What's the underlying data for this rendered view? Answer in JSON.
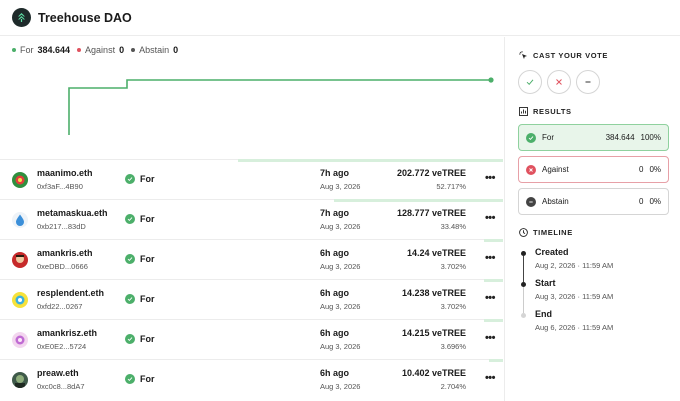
{
  "app": {
    "title": "Treehouse DAO"
  },
  "tally": {
    "for_label": "For",
    "for_value": "384.644",
    "against_label": "Against",
    "against_value": "0",
    "abstain_label": "Abstain",
    "abstain_value": "0"
  },
  "colors": {
    "for": "#4caf6a",
    "against": "#e0525f",
    "abstain": "#555555",
    "bar": "#d7efdc"
  },
  "votes": [
    {
      "name": "maanimo.eth",
      "address": "0xf3aF...4B90",
      "choice": "For",
      "ago": "7h ago",
      "date": "Aug 3, 2026",
      "power": "202.772 veTREE",
      "percent": "52.717%",
      "share": 0.527,
      "avatar": "green"
    },
    {
      "name": "metamaskua.eth",
      "address": "0xb217...83dD",
      "choice": "For",
      "ago": "7h ago",
      "date": "Aug 3, 2026",
      "power": "128.777 veTREE",
      "percent": "33.48%",
      "share": 0.335,
      "avatar": "drop"
    },
    {
      "name": "amankris.eth",
      "address": "0xeDBD...0666",
      "choice": "For",
      "ago": "6h ago",
      "date": "Aug 3, 2026",
      "power": "14.24 veTREE",
      "percent": "3.702%",
      "share": 0.037,
      "avatar": "red"
    },
    {
      "name": "resplendent.eth",
      "address": "0xfd22...0267",
      "choice": "For",
      "ago": "6h ago",
      "date": "Aug 3, 2026",
      "power": "14.238 veTREE",
      "percent": "3.702%",
      "share": 0.037,
      "avatar": "yellow"
    },
    {
      "name": "amankrisz.eth",
      "address": "0xE0E2...5724",
      "choice": "For",
      "ago": "6h ago",
      "date": "Aug 3, 2026",
      "power": "14.215 veTREE",
      "percent": "3.696%",
      "share": 0.037,
      "avatar": "pink"
    },
    {
      "name": "preaw.eth",
      "address": "0xc0c8...8dA7",
      "choice": "For",
      "ago": "6h ago",
      "date": "Aug 3, 2026",
      "power": "10.402 veTREE",
      "percent": "2.704%",
      "share": 0.027,
      "avatar": "dark"
    }
  ],
  "cast": {
    "title": "CAST YOUR VOTE"
  },
  "results": {
    "title": "RESULTS",
    "for": {
      "label": "For",
      "value": "384.644",
      "percent": "100%"
    },
    "against": {
      "label": "Against",
      "value": "0",
      "percent": "0%"
    },
    "abstain": {
      "label": "Abstain",
      "value": "0",
      "percent": "0%"
    }
  },
  "timeline": {
    "title": "TIMELINE",
    "created": {
      "label": "Created",
      "date": "Aug 2, 2026 · 11:59 AM"
    },
    "start": {
      "label": "Start",
      "date": "Aug 3, 2026 · 11:59 AM"
    },
    "end": {
      "label": "End",
      "date": "Aug 6, 2026 · 11:59 AM"
    }
  }
}
